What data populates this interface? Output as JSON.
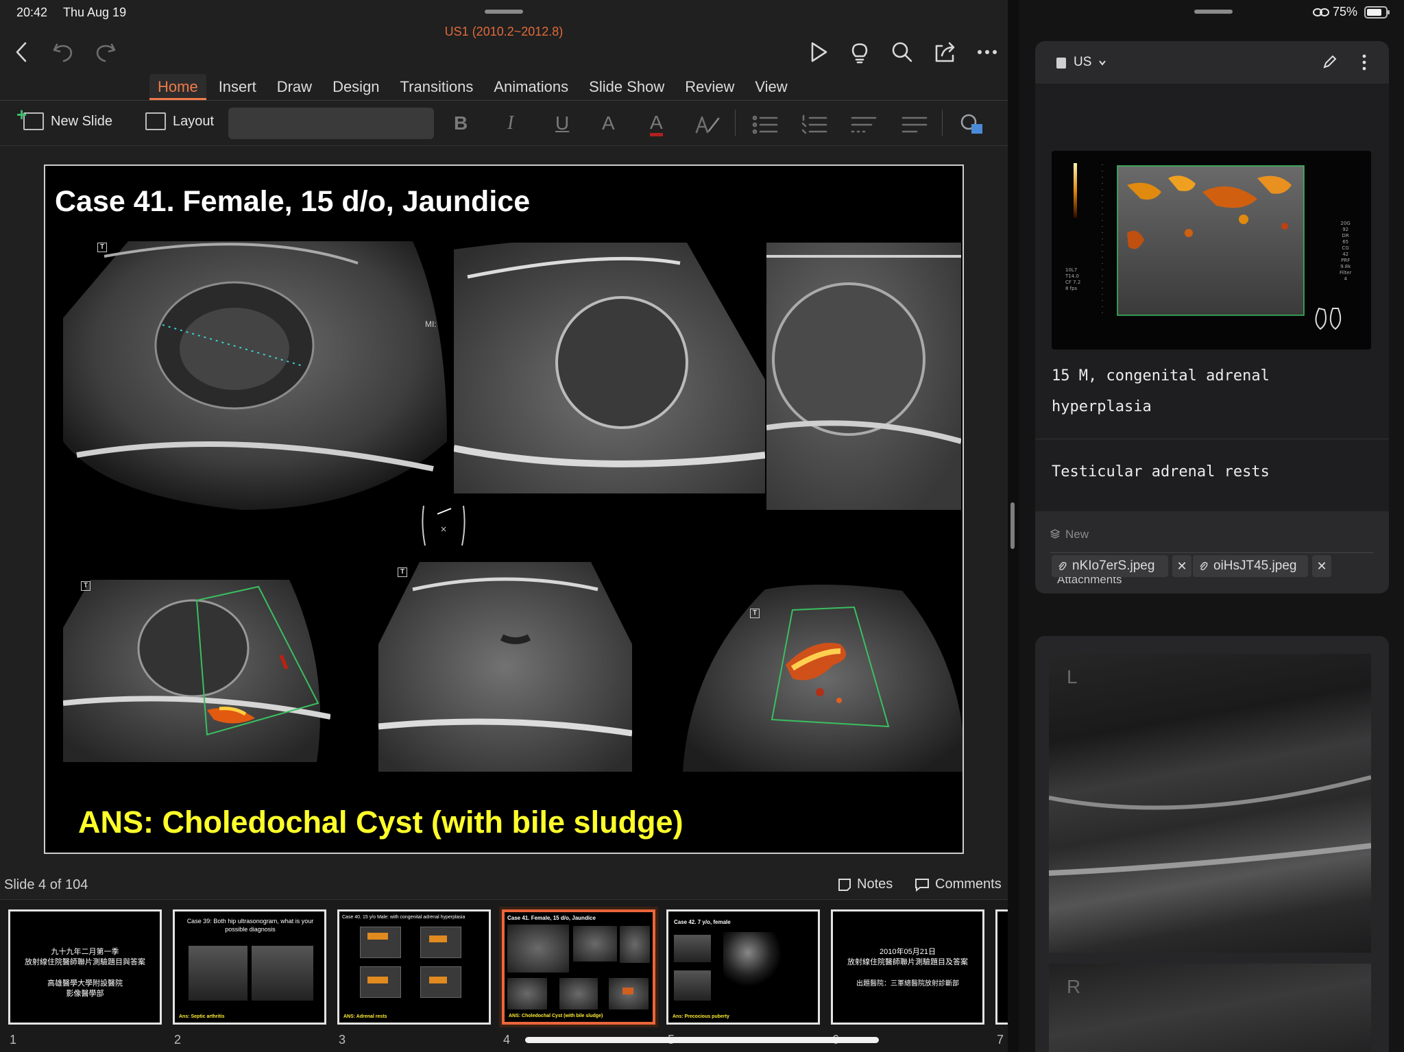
{
  "status_bar": {
    "time": "20:42",
    "date": "Thu Aug 19",
    "battery": "75%"
  },
  "doc": {
    "title": "US1 (2010.2~2012.8)"
  },
  "toolbar": {
    "back": "back-icon",
    "undo": "undo-icon",
    "redo": "redo-icon",
    "play": "play-icon",
    "ideas": "lightbulb-icon",
    "search": "search-icon",
    "share": "share-icon",
    "more": "more-icon"
  },
  "tabs": [
    "Home",
    "Insert",
    "Draw",
    "Design",
    "Transitions",
    "Animations",
    "Slide Show",
    "Review",
    "View"
  ],
  "active_tab": "Home",
  "ribbon": {
    "new_slide": "New Slide",
    "layout": "Layout",
    "bold": "B",
    "italic": "I",
    "underline": "U",
    "font_size": "A",
    "font_color": "A"
  },
  "slide": {
    "title": "Case 41.  Female, 15 d/o, Jaundice",
    "answer": "ANS: Choledochal Cyst (with bile sludge)",
    "mi_label": "MI:"
  },
  "footer": {
    "slide_info": "Slide 4 of 104",
    "notes": "Notes",
    "comments": "Comments"
  },
  "thumbnails": [
    {
      "num": "1",
      "lines": [
        "九十九年二月第一季",
        "放射線住院醫師聯片測驗題目與答案",
        "",
        "高雄醫學大學附設醫院",
        "影像醫學部"
      ]
    },
    {
      "num": "2",
      "title": "Case 39: Both hip ultrasonogram, what is your possible diagnosis",
      "ans": "Ans: Septic arthritis"
    },
    {
      "num": "3",
      "title": "Case 40. 15 y/o Male: with congenital adrenal hyperplasia",
      "ans": "ANS: Adrenal rests"
    },
    {
      "num": "4",
      "title": "Case 41.  Female, 15 d/o, Jaundice",
      "ans": "ANS: Choledochal Cyst (with bile sludge)"
    },
    {
      "num": "5",
      "title": "Case 42.  7 y/o, female",
      "ans": "Ans: Precocious puberty"
    },
    {
      "num": "6",
      "lines": [
        "2010年05月21日",
        "放射線住院醫師聯片測驗題目及答案",
        "",
        "出題醫院：三軍總醫院放射診斷部"
      ]
    },
    {
      "num": "7"
    }
  ],
  "notes_pane": {
    "folder": "US",
    "note_text_1": "15 M, congenital adrenal hyperplasia",
    "note_text_2": "Testicular adrenal rests",
    "new_label": "New",
    "attachments_label": "Attachments",
    "attachments": [
      "nKIo7erS.jpeg",
      "oiHsJT45.jpeg"
    ],
    "us_image_labels": [
      "L",
      "R"
    ],
    "doppler_labels": [
      "20G",
      "92",
      "DR",
      "65",
      "CG",
      "42",
      "PRF",
      "9.8k",
      "Filter",
      "4",
      "10L7",
      "T14.0",
      "CF 7.2",
      "8 fps"
    ]
  },
  "colors": {
    "accent": "#ef7a4a",
    "title_red": "#e06a3a",
    "answer_yellow": "#ffff2a",
    "selection": "#e9663a"
  }
}
